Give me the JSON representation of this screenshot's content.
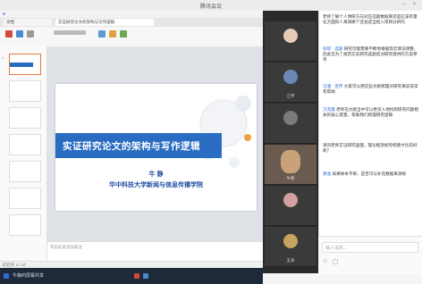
{
  "window": {
    "title": "腾讯会议"
  },
  "share": {
    "tabs": [
      "文档",
      "实证研究论文的架构与写作逻辑"
    ],
    "slide_title": "实证研究论文的架构与写作逻辑",
    "author_name": "牛 静",
    "author_affil": "华中科技大学新闻与信息传播学院",
    "notes_placeholder": "单击此处添加备注",
    "status_text": "幻灯片 1 / 47",
    "taskbar_label": "牛静的屏幕共享"
  },
  "videos": [
    {
      "name": "",
      "color": "#e8c9b8"
    },
    {
      "name": "江宇",
      "color": "#6b88b8"
    },
    {
      "name": "牛静",
      "color": "#c9a27a"
    },
    {
      "name": "",
      "color": "#7a7a7a"
    },
    {
      "name": "",
      "color": "#d2a0a0"
    },
    {
      "name": "王冰",
      "color": "#c6a35f"
    }
  ],
  "chat": {
    "messages": [
      {
        "who": "",
        "text": "老师了解个人预研方向对应选题数据库还是应该有量化方面的人来请哪个还会适当给入项目分析吗"
      },
      {
        "who": "张琼 · 选题",
        "text": "研究可能需要不断地根据现实情况调整，因此在为了规范实证研究选题后对研究提供的方案参考"
      },
      {
        "who": "汪涵 · 宣传",
        "text": "大家可以把这些文献梳理对研究来说非常有帮助"
      },
      {
        "who": "汉克鑫",
        "text": "老师在文献当中可以更深入地找到研究问题相关的核心变量，帮助我们梳理研究逻辑"
      },
      {
        "who": "",
        "text": "请问老师实证研究里面，理论框架如何构建才比较好呢？"
      },
      {
        "who": "黄逸",
        "text": "如果样本不够，是否可以补充数据来源呢"
      }
    ],
    "input_placeholder": "输入消息..."
  }
}
